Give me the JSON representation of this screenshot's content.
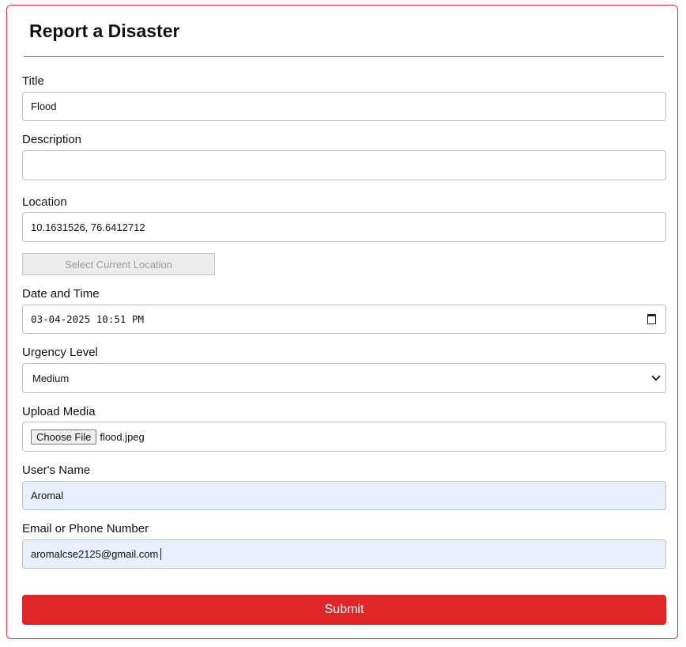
{
  "form": {
    "title": "Report a Disaster",
    "fields": {
      "title": {
        "label": "Title",
        "value": "Flood"
      },
      "description": {
        "label": "Description",
        "value": ""
      },
      "location": {
        "label": "Location",
        "value": "10.1631526, 76.6412712"
      },
      "datetime": {
        "label": "Date and Time",
        "value": "03-04-2025 10:51 PM"
      },
      "urgency": {
        "label": "Urgency Level",
        "value": "Medium"
      },
      "media": {
        "label": "Upload Media",
        "button_label": "Choose File",
        "file_name": "flood.jpeg"
      },
      "name": {
        "label": "User's Name",
        "value": "Aromal"
      },
      "contact": {
        "label": "Email or Phone Number",
        "value": "aromalcse2125@gmail.com"
      }
    },
    "select_location_label": "Select Current Location",
    "submit_label": "Submit"
  },
  "colors": {
    "accent": "#de2626",
    "border_accent": "#d9363a",
    "autofill_background": "#e8f0fe"
  }
}
